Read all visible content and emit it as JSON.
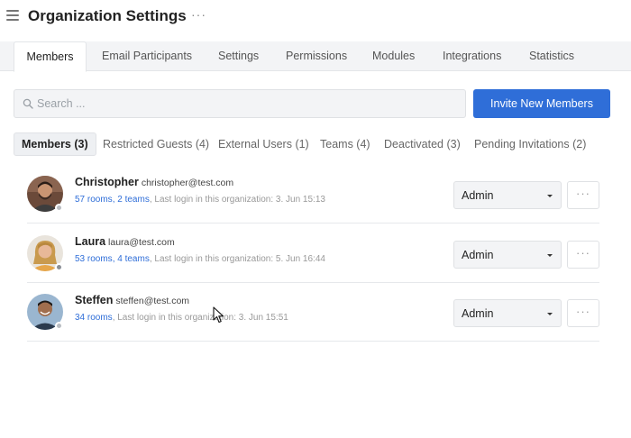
{
  "header": {
    "title": "Organization Settings",
    "more": "···",
    "menu_icon": "hamburger-menu-icon"
  },
  "tabs": [
    {
      "label": "Members",
      "active": true
    },
    {
      "label": "Email Participants",
      "active": false
    },
    {
      "label": "Settings",
      "active": false
    },
    {
      "label": "Permissions",
      "active": false
    },
    {
      "label": "Modules",
      "active": false
    },
    {
      "label": "Integrations",
      "active": false
    },
    {
      "label": "Statistics",
      "active": false
    }
  ],
  "search": {
    "placeholder": "Search ...",
    "value": "",
    "icon": "search-icon"
  },
  "invite_button": "Invite New Members",
  "subtabs": [
    {
      "label": "Members (3)",
      "active": true
    },
    {
      "label": "Restricted Guests (4)",
      "active": false
    },
    {
      "label": "External Users (1)",
      "active": false
    },
    {
      "label": "Teams (4)",
      "active": false
    },
    {
      "label": "Deactivated (3)",
      "active": false
    },
    {
      "label": "Pending Invitations (2)",
      "active": false
    }
  ],
  "members": [
    {
      "name": "Christopher",
      "email": "christopher@test.com",
      "rooms": "57 rooms",
      "teams": "2 teams",
      "last_login": ", Last login in this organization: 3. Jun 15:13",
      "role": "Admin",
      "more": "···"
    },
    {
      "name": "Laura",
      "email": "laura@test.com",
      "rooms": "53 rooms",
      "teams": "4 teams",
      "last_login": ", Last login in this organization: 5. Jun 16:44",
      "role": "Admin",
      "more": "···"
    },
    {
      "name": "Steffen",
      "email": "steffen@test.com",
      "rooms": "34 rooms",
      "teams": "",
      "last_login": ", Last login in this organization: 3. Jun 15:51",
      "role": "Admin",
      "more": "···"
    }
  ],
  "colors": {
    "accent": "#2f6ed8",
    "tab_background": "#f3f4f6",
    "border": "#dfe1e4",
    "presence": "#b9bdc2"
  }
}
